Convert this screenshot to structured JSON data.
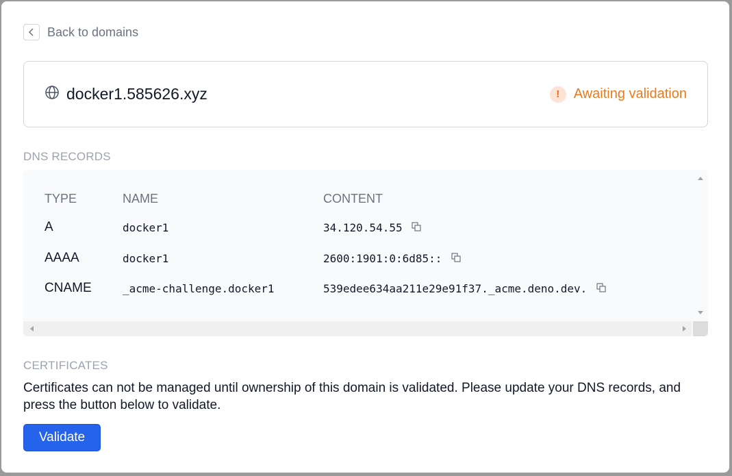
{
  "back_link": {
    "label": "Back to domains"
  },
  "domain": {
    "name": "docker1.585626.xyz",
    "status_text": "Awaiting validation",
    "status_icon": "!",
    "status_color": "#ea7a1c"
  },
  "dns": {
    "title": "DNS RECORDS",
    "headers": {
      "type": "TYPE",
      "name": "NAME",
      "content": "CONTENT"
    },
    "records": [
      {
        "type": "A",
        "name": "docker1",
        "content": "34.120.54.55"
      },
      {
        "type": "AAAA",
        "name": "docker1",
        "content": "2600:1901:0:6d85::"
      },
      {
        "type": "CNAME",
        "name": "_acme-challenge.docker1",
        "content": "539edee634aa211e29e91f37._acme.deno.dev."
      }
    ]
  },
  "certificates": {
    "title": "CERTIFICATES",
    "description": "Certificates can not be managed until ownership of this domain is validated. Please update your DNS records, and press the button below to validate.",
    "button_label": "Validate"
  },
  "colors": {
    "accent": "#2563eb",
    "warning": "#ea7a1c",
    "muted": "#9ca3af"
  }
}
